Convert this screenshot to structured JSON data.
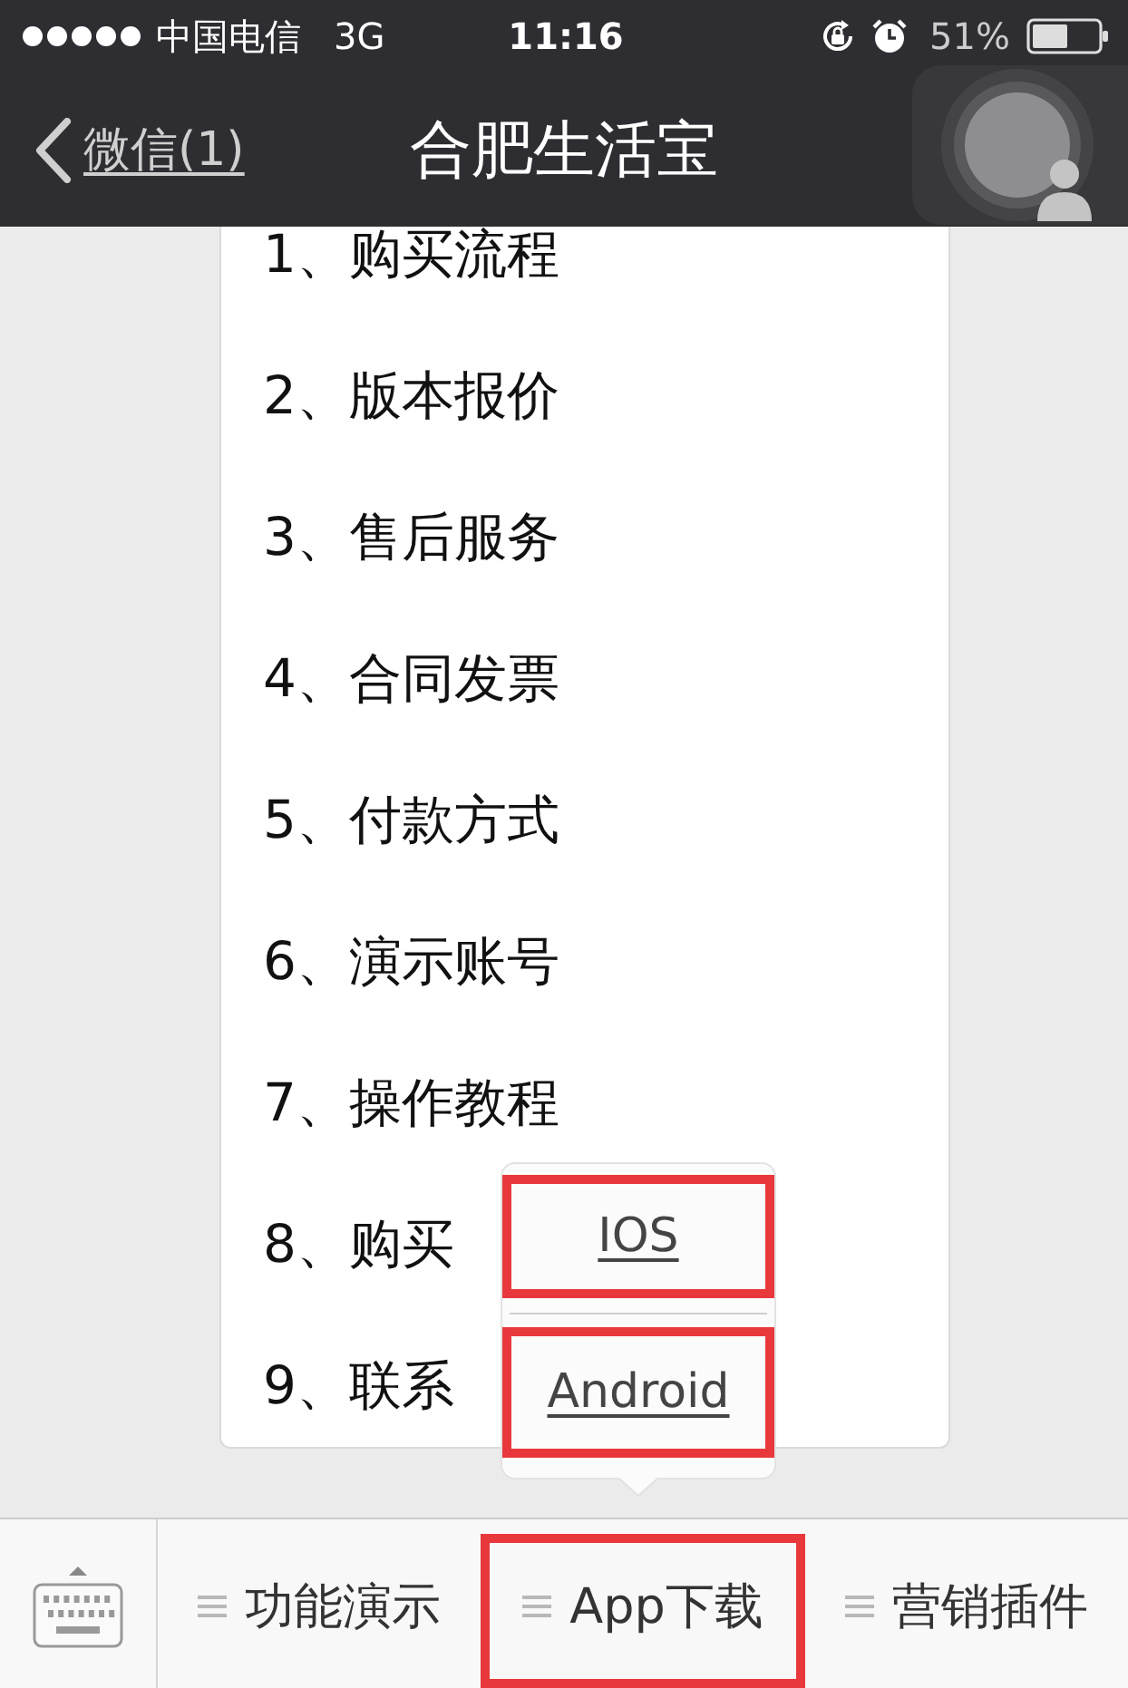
{
  "status_bar": {
    "carrier": "中国电信",
    "network": "3G",
    "time": "11:16",
    "battery": "51%"
  },
  "nav_bar": {
    "back": "微信(1)",
    "title": "合肥生活宝"
  },
  "menu_list": {
    "items": [
      "1、购买流程",
      "2、版本报价",
      "3、售后服务",
      "4、合同发票",
      "5、付款方式",
      "6、演示账号",
      "7、操作教程",
      "8、购买",
      "9、联系"
    ]
  },
  "popup_menu": {
    "items": [
      {
        "label": "IOS",
        "highlighted": true
      },
      {
        "label": "Android",
        "highlighted": true
      }
    ]
  },
  "bottom_bar": {
    "tabs": [
      {
        "label": "功能演示",
        "highlighted": false
      },
      {
        "label": "App下载",
        "highlighted": true
      },
      {
        "label": "营销插件",
        "highlighted": false
      }
    ]
  }
}
